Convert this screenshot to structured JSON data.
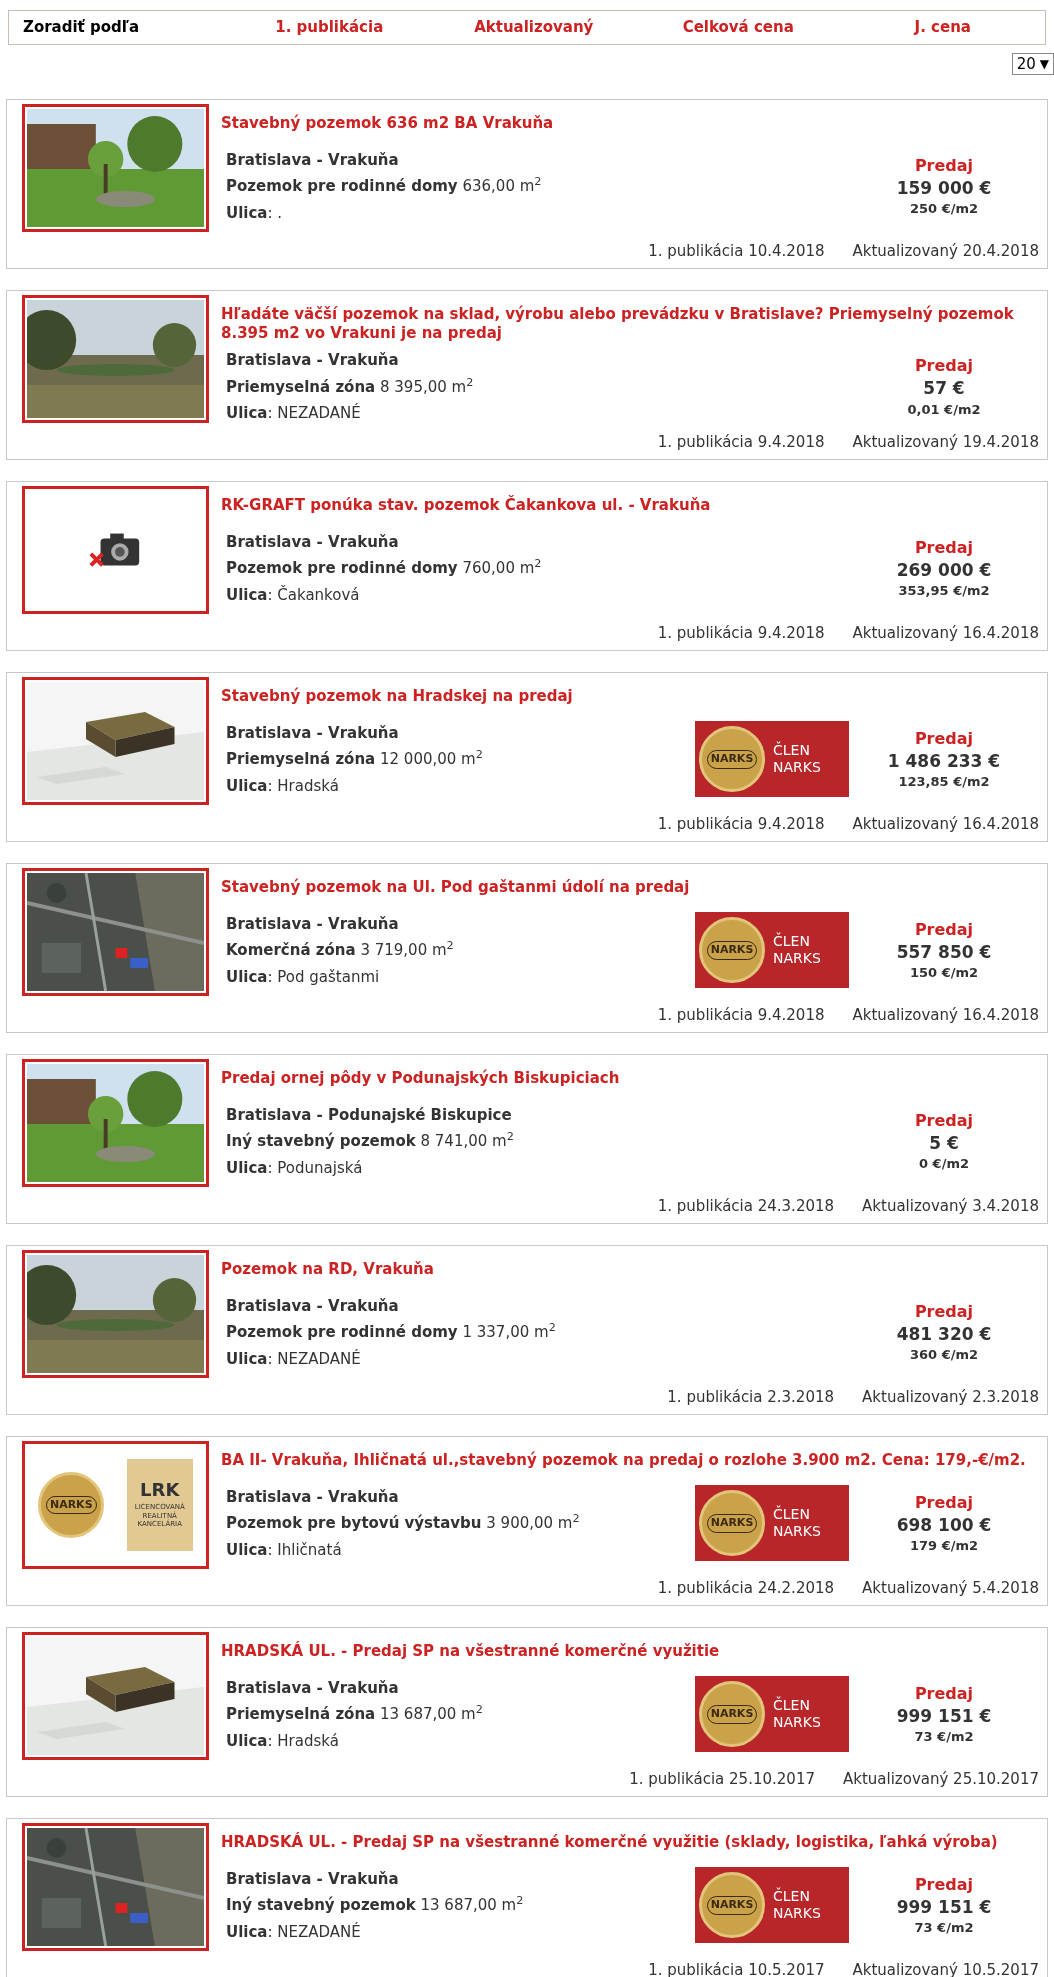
{
  "sort_bar": {
    "label": "Zoradiť podľa",
    "options": [
      "1. publikácia",
      "Aktualizovaný",
      "Celková cena",
      "J. cena"
    ]
  },
  "page_size": {
    "value": "20",
    "arrow": "▼"
  },
  "listings": [
    {
      "title": "Stavebný pozemok 636 m2 BA Vrakuňa",
      "location": "Bratislava - Vrakuňa",
      "type": "Pozemok pre rodinné domy",
      "area": "636,00 m$^{2}$",
      "street": "**Ulica**: .",
      "offer": "Predaj",
      "price": "159 000 €",
      "unit_price": "250 €/m2",
      "published": "1. publikácia 10.4.2018",
      "updated": "Aktualizovaný 20.4.2018"
    },
    {
      "title": "Hľadáte väčší pozemok na sklad, výrobu alebo prevádzku v Bratislave? Priemyselný pozemok 8.395 m2 vo Vrakuni je na predaj",
      "location": "Bratislava - Vrakuňa",
      "type": "Priemyselná zóna",
      "area": "8 395,00 m$^{2}$",
      "street": "**Ulica**: NEZADANÉ",
      "offer": "Predaj",
      "price": "57 €",
      "unit_price": "0,01 €/m2",
      "published": "1. publikácia 9.4.2018",
      "updated": "Aktualizovaný 19.4.2018"
    },
    {
      "image": {
        "kind": "no-photo"
      },
      "title": "RK-GRAFT ponúka stav. pozemok Čakankova ul. - Vrakuňa",
      "location": "Bratislava - Vrakuňa",
      "type": "Pozemok pre rodinné domy",
      "area": "760,00 m$^{2}$",
      "street": "**Ulica**: Čakanková",
      "offer": "Predaj",
      "price": "269 000 €",
      "unit_price": "353,95 €/m2",
      "published": "1. publikácia 9.4.2018",
      "updated": "Aktualizovaný 16.4.2018"
    },
    {
      "title": "Stavebný pozemok na Hradskej na predaj",
      "location": "Bratislava - Vrakuňa",
      "type": "Priemyselná zóna",
      "area": "12 000,00 m$^{2}$",
      "street": "**Ulica**: Hradská",
      "badge": {
        "seal": "NARKS",
        "lines": [
          "ČLEN",
          "NARKS"
        ]
      },
      "offer": "Predaj",
      "price": "1 486 233 €",
      "unit_price": "123,85 €/m2",
      "published": "1. publikácia 9.4.2018",
      "updated": "Aktualizovaný 16.4.2018"
    },
    {
      "title": "Stavebný pozemok na Ul. Pod gaštanmi údolí na predaj",
      "location": "Bratislava - Vrakuňa",
      "type": "Komerčná zóna",
      "area": "3 719,00 m$^{2}$",
      "street": "**Ulica**: Pod gaštanmi",
      "badge": {
        "seal": "NARKS",
        "lines": [
          "ČLEN",
          "NARKS"
        ]
      },
      "offer": "Predaj",
      "price": "557 850 €",
      "unit_price": "150 €/m2",
      "published": "1. publikácia 9.4.2018",
      "updated": "Aktualizovaný 16.4.2018"
    },
    {
      "title": "Predaj ornej pôdy v Podunajských Biskupiciach",
      "location": "Bratislava - Podunajské Biskupice",
      "type": "Iný stavebný pozemok",
      "area": "8 741,00 m$^{2}$",
      "street": "**Ulica**: Podunajská",
      "offer": "Predaj",
      "price": "5 €",
      "unit_price": "0 €/m2",
      "published": "1. publikácia 24.3.2018",
      "updated": "Aktualizovaný 3.4.2018"
    },
    {
      "title": "Pozemok na RD, Vrakuňa",
      "location": "Bratislava - Vrakuňa",
      "type": "Pozemok pre rodinné domy",
      "area": "1 337,00 m$^{2}$",
      "street": "**Ulica**: NEZADANÉ",
      "offer": "Predaj",
      "price": "481 320 €",
      "unit_price": "360 €/m2",
      "published": "1. publikácia 2.3.2018",
      "updated": "Aktualizovaný 2.3.2018"
    },
    {
      "image": {
        "kind": "logos",
        "seal": "NARKS",
        "mark": "LRK",
        "caption": [
          "LICENCOVANÁ",
          "REALITNÁ",
          "KANCELÁRIA"
        ]
      },
      "title": "BA II- Vrakuňa, Ihličnatá ul.,stavebný pozemok na predaj o rozlohe 3.900 m2. Cena: 179,-€/m2.",
      "location": "Bratislava - Vrakuňa",
      "type": "Pozemok pre bytovú výstavbu",
      "area": "3 900,00 m$^{2}$",
      "street": "**Ulica**: Ihličnatá",
      "badge": {
        "seal": "NARKS",
        "lines": [
          "ČLEN",
          "NARKS"
        ]
      },
      "offer": "Predaj",
      "price": "698 100 €",
      "unit_price": "179 €/m2",
      "published": "1. publikácia 24.2.2018",
      "updated": "Aktualizovaný 5.4.2018"
    },
    {
      "title": "HRADSKÁ UL. - Predaj SP na všestranné komerčné využitie",
      "location": "Bratislava - Vrakuňa",
      "type": "Priemyselná zóna",
      "area": "13 687,00 m$^{2}$",
      "street": "**Ulica**: Hradská",
      "badge": {
        "seal": "NARKS",
        "lines": [
          "ČLEN",
          "NARKS"
        ]
      },
      "offer": "Predaj",
      "price": "999 151 €",
      "unit_price": "73 €/m2",
      "published": "1. publikácia 25.10.2017",
      "updated": "Aktualizovaný 25.10.2017"
    },
    {
      "title": "HRADSKÁ UL. - Predaj SP na všestranné komerčné využitie (sklady, logistika, ľahká výroba)",
      "location": "Bratislava - Vrakuňa",
      "type": "Iný stavebný pozemok",
      "area": "13 687,00 m$^{2}$",
      "street": "**Ulica**: NEZADANÉ",
      "badge": {
        "seal": "NARKS",
        "lines": [
          "ČLEN",
          "NARKS"
        ]
      },
      "offer": "Predaj",
      "price": "999 151 €",
      "unit_price": "73 €/m2",
      "published": "1. publikácia 10.5.2017",
      "updated": "Aktualizovaný 10.5.2017"
    }
  ]
}
